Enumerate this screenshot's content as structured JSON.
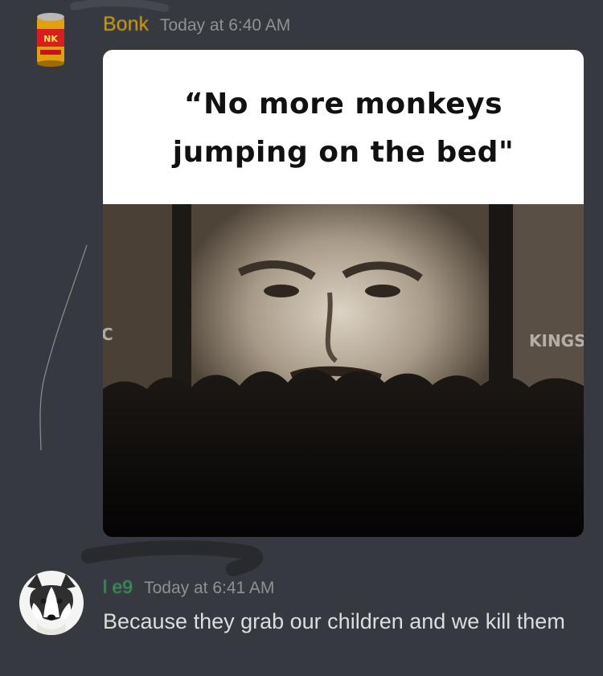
{
  "colors": {
    "background": "#36393f",
    "author_1": "#d4a017",
    "author_2": "#3ba55d",
    "timestamp": "#8e9297",
    "message_text": "#dcddde"
  },
  "messages": [
    {
      "author": "Bonk",
      "timestamp": "Today at 6:40 AM",
      "avatar_icon": "soda-can-icon",
      "attachment": {
        "caption_lines": [
          "“No more monkeys",
          "jumping on the bed\""
        ],
        "screen_sign_left": "C",
        "screen_sign_right": "KINGS"
      }
    },
    {
      "author": "l     e9",
      "timestamp": "Today at 6:41 AM",
      "avatar_icon": "husky-dog-icon",
      "text": "Because they grab our children and we kill them"
    }
  ]
}
